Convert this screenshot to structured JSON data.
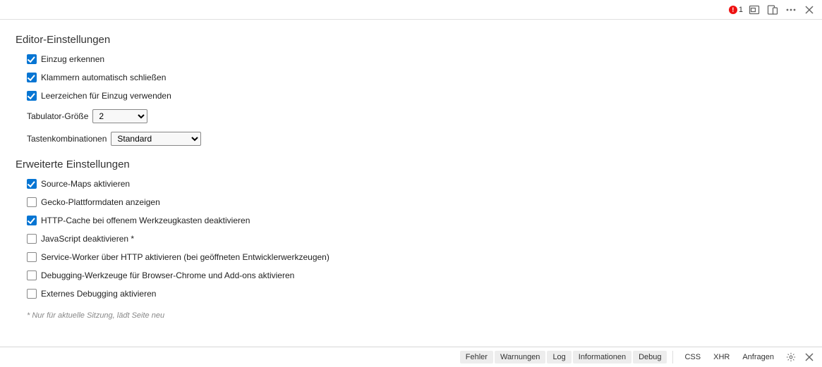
{
  "topbar": {
    "error_count": "1"
  },
  "editor": {
    "title": "Editor-Einstellungen",
    "detect_indent": "Einzug erkennen",
    "autoclose_brackets": "Klammern automatisch schließen",
    "use_spaces": "Leerzeichen für Einzug verwenden",
    "tab_size_label": "Tabulator-Größe",
    "tab_size_value": "2",
    "keybindings_label": "Tastenkombinationen",
    "keybindings_value": "Standard"
  },
  "advanced": {
    "title": "Erweiterte Einstellungen",
    "source_maps": "Source-Maps aktivieren",
    "gecko_platform": "Gecko-Plattformdaten anzeigen",
    "http_cache": "HTTP-Cache bei offenem Werkzeugkasten deaktivieren",
    "disable_js": "JavaScript deaktivieren *",
    "service_worker": "Service-Worker über HTTP aktivieren (bei geöffneten Entwicklerwerkzeugen)",
    "chrome_debug": "Debugging-Werkzeuge für Browser-Chrome und Add-ons aktivieren",
    "remote_debug": "Externes Debugging aktivieren",
    "footnote": "* Nur für aktuelle Sitzung, lädt Seite neu"
  },
  "filters": {
    "errors": "Fehler",
    "warnings": "Warnungen",
    "log": "Log",
    "info": "Informationen",
    "debug": "Debug",
    "css": "CSS",
    "xhr": "XHR",
    "requests": "Anfragen"
  }
}
